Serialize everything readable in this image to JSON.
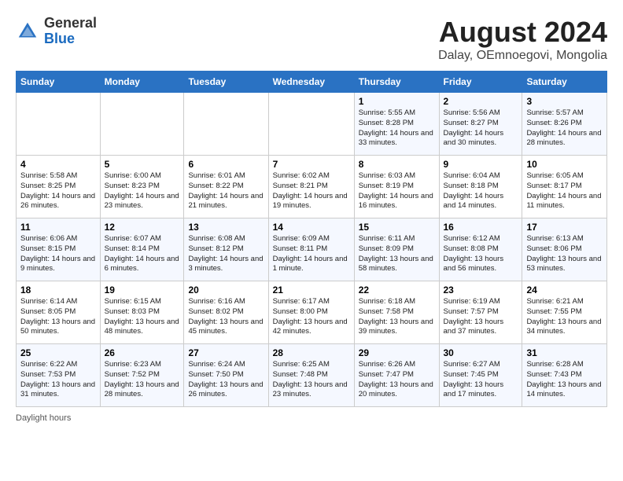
{
  "header": {
    "logo_general": "General",
    "logo_blue": "Blue",
    "title": "August 2024",
    "subtitle": "Dalay, OEmnoegovi, Mongolia"
  },
  "days_of_week": [
    "Sunday",
    "Monday",
    "Tuesday",
    "Wednesday",
    "Thursday",
    "Friday",
    "Saturday"
  ],
  "weeks": [
    [
      {
        "num": "",
        "detail": ""
      },
      {
        "num": "",
        "detail": ""
      },
      {
        "num": "",
        "detail": ""
      },
      {
        "num": "",
        "detail": ""
      },
      {
        "num": "1",
        "detail": "Sunrise: 5:55 AM\nSunset: 8:28 PM\nDaylight: 14 hours and 33 minutes."
      },
      {
        "num": "2",
        "detail": "Sunrise: 5:56 AM\nSunset: 8:27 PM\nDaylight: 14 hours and 30 minutes."
      },
      {
        "num": "3",
        "detail": "Sunrise: 5:57 AM\nSunset: 8:26 PM\nDaylight: 14 hours and 28 minutes."
      }
    ],
    [
      {
        "num": "4",
        "detail": "Sunrise: 5:58 AM\nSunset: 8:25 PM\nDaylight: 14 hours and 26 minutes."
      },
      {
        "num": "5",
        "detail": "Sunrise: 6:00 AM\nSunset: 8:23 PM\nDaylight: 14 hours and 23 minutes."
      },
      {
        "num": "6",
        "detail": "Sunrise: 6:01 AM\nSunset: 8:22 PM\nDaylight: 14 hours and 21 minutes."
      },
      {
        "num": "7",
        "detail": "Sunrise: 6:02 AM\nSunset: 8:21 PM\nDaylight: 14 hours and 19 minutes."
      },
      {
        "num": "8",
        "detail": "Sunrise: 6:03 AM\nSunset: 8:19 PM\nDaylight: 14 hours and 16 minutes."
      },
      {
        "num": "9",
        "detail": "Sunrise: 6:04 AM\nSunset: 8:18 PM\nDaylight: 14 hours and 14 minutes."
      },
      {
        "num": "10",
        "detail": "Sunrise: 6:05 AM\nSunset: 8:17 PM\nDaylight: 14 hours and 11 minutes."
      }
    ],
    [
      {
        "num": "11",
        "detail": "Sunrise: 6:06 AM\nSunset: 8:15 PM\nDaylight: 14 hours and 9 minutes."
      },
      {
        "num": "12",
        "detail": "Sunrise: 6:07 AM\nSunset: 8:14 PM\nDaylight: 14 hours and 6 minutes."
      },
      {
        "num": "13",
        "detail": "Sunrise: 6:08 AM\nSunset: 8:12 PM\nDaylight: 14 hours and 3 minutes."
      },
      {
        "num": "14",
        "detail": "Sunrise: 6:09 AM\nSunset: 8:11 PM\nDaylight: 14 hours and 1 minute."
      },
      {
        "num": "15",
        "detail": "Sunrise: 6:11 AM\nSunset: 8:09 PM\nDaylight: 13 hours and 58 minutes."
      },
      {
        "num": "16",
        "detail": "Sunrise: 6:12 AM\nSunset: 8:08 PM\nDaylight: 13 hours and 56 minutes."
      },
      {
        "num": "17",
        "detail": "Sunrise: 6:13 AM\nSunset: 8:06 PM\nDaylight: 13 hours and 53 minutes."
      }
    ],
    [
      {
        "num": "18",
        "detail": "Sunrise: 6:14 AM\nSunset: 8:05 PM\nDaylight: 13 hours and 50 minutes."
      },
      {
        "num": "19",
        "detail": "Sunrise: 6:15 AM\nSunset: 8:03 PM\nDaylight: 13 hours and 48 minutes."
      },
      {
        "num": "20",
        "detail": "Sunrise: 6:16 AM\nSunset: 8:02 PM\nDaylight: 13 hours and 45 minutes."
      },
      {
        "num": "21",
        "detail": "Sunrise: 6:17 AM\nSunset: 8:00 PM\nDaylight: 13 hours and 42 minutes."
      },
      {
        "num": "22",
        "detail": "Sunrise: 6:18 AM\nSunset: 7:58 PM\nDaylight: 13 hours and 39 minutes."
      },
      {
        "num": "23",
        "detail": "Sunrise: 6:19 AM\nSunset: 7:57 PM\nDaylight: 13 hours and 37 minutes."
      },
      {
        "num": "24",
        "detail": "Sunrise: 6:21 AM\nSunset: 7:55 PM\nDaylight: 13 hours and 34 minutes."
      }
    ],
    [
      {
        "num": "25",
        "detail": "Sunrise: 6:22 AM\nSunset: 7:53 PM\nDaylight: 13 hours and 31 minutes."
      },
      {
        "num": "26",
        "detail": "Sunrise: 6:23 AM\nSunset: 7:52 PM\nDaylight: 13 hours and 28 minutes."
      },
      {
        "num": "27",
        "detail": "Sunrise: 6:24 AM\nSunset: 7:50 PM\nDaylight: 13 hours and 26 minutes."
      },
      {
        "num": "28",
        "detail": "Sunrise: 6:25 AM\nSunset: 7:48 PM\nDaylight: 13 hours and 23 minutes."
      },
      {
        "num": "29",
        "detail": "Sunrise: 6:26 AM\nSunset: 7:47 PM\nDaylight: 13 hours and 20 minutes."
      },
      {
        "num": "30",
        "detail": "Sunrise: 6:27 AM\nSunset: 7:45 PM\nDaylight: 13 hours and 17 minutes."
      },
      {
        "num": "31",
        "detail": "Sunrise: 6:28 AM\nSunset: 7:43 PM\nDaylight: 13 hours and 14 minutes."
      }
    ]
  ],
  "footer": {
    "daylight_label": "Daylight hours"
  }
}
